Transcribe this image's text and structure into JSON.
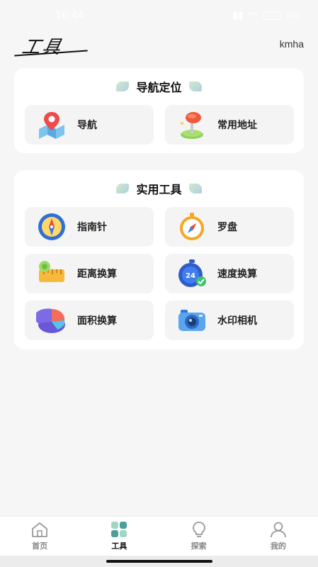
{
  "status_bar": {
    "time": "16:44",
    "battery": "100"
  },
  "header": {
    "logo_text": "工具",
    "user_name": "kmha"
  },
  "nav_section": {
    "title": "导航定位",
    "items": [
      {
        "label": "导航",
        "icon": "map-pin-icon"
      },
      {
        "label": "常用地址",
        "icon": "push-pin-icon"
      }
    ]
  },
  "tools_section": {
    "title": "实用工具",
    "items": [
      {
        "label": "指南针",
        "icon": "compass-dial-icon"
      },
      {
        "label": "罗盘",
        "icon": "compass-icon"
      },
      {
        "label": "距离换算",
        "icon": "ruler-icon"
      },
      {
        "label": "速度换算",
        "icon": "stopwatch-icon"
      },
      {
        "label": "面积换算",
        "icon": "pie-chart-icon"
      },
      {
        "label": "水印相机",
        "icon": "camera-icon"
      }
    ]
  },
  "tabbar": {
    "tabs": [
      {
        "label": "首页",
        "icon": "home-icon"
      },
      {
        "label": "工具",
        "icon": "grid-icon",
        "active": true
      },
      {
        "label": "探索",
        "icon": "lightbulb-icon"
      },
      {
        "label": "我的",
        "icon": "user-icon"
      }
    ]
  },
  "colors": {
    "accent": "#4caf7d",
    "tile_bg": "#f4f4f4",
    "card_bg": "#ffffff"
  }
}
